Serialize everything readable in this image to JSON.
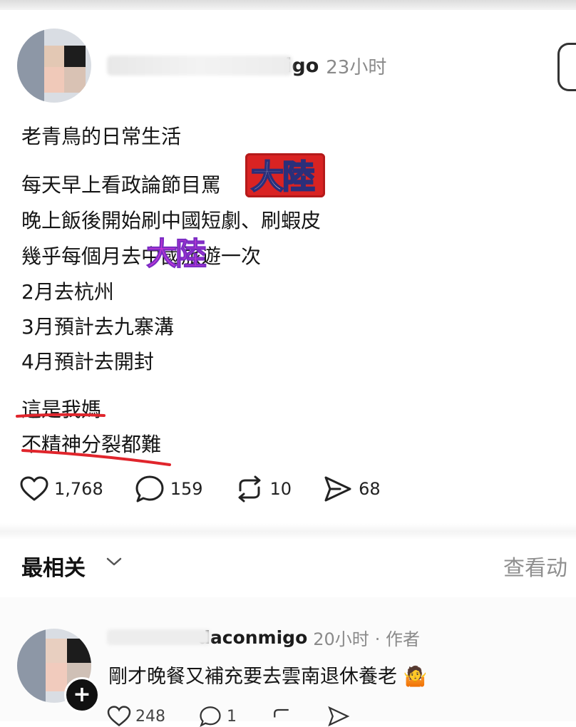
{
  "post": {
    "author_handle": "migo",
    "time": "23小时",
    "lines": [
      "老青鳥的日常生活",
      "每天早上看政論節目罵",
      "晚上飯後開始刷中國短劇、刷蝦皮",
      "幾乎每個月去中國旅遊一次",
      "2月去杭州",
      "3月預計去九寨溝",
      "4月預計去開封",
      "這是我媽",
      "不精神分裂都難"
    ],
    "stickers": {
      "red": "大陸",
      "pink": "大陸"
    }
  },
  "actions": {
    "likes": "1,768",
    "comments": "159",
    "reposts": "10",
    "shares": "68"
  },
  "comments_section": {
    "sort_label": "最相关",
    "view_activity": "查看动"
  },
  "reply": {
    "handle": "daconmigo",
    "time": "20小时",
    "author_tag": "· 作者",
    "text": "剛才晚餐又補充要去雲南退休養老",
    "emoji": "🤷",
    "likes": "248",
    "comments": "1"
  },
  "colors": {
    "underline": "#e0252c",
    "sticker_red": "#d92323",
    "sticker_pink": "#d43bd6",
    "muted": "#8a8a8a"
  }
}
